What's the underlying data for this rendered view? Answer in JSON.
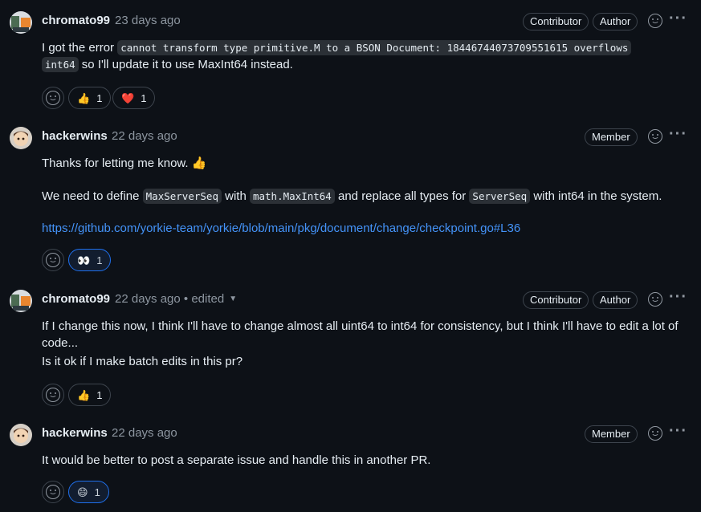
{
  "comments": [
    {
      "author": "chromato99",
      "time": "23 days ago",
      "badges": [
        "Contributor",
        "Author"
      ],
      "body": {
        "p1_pre": "I got the error ",
        "p1_code": "cannot transform type primitive.M to a BSON Document: 18446744073709551615 overflows",
        "p1_code2": "int64",
        "p1_post": " so I'll update it to use MaxInt64 instead."
      },
      "reactions": [
        {
          "emoji": "👍",
          "count": "1"
        },
        {
          "emoji": "❤️",
          "count": "1"
        }
      ]
    },
    {
      "author": "hackerwins",
      "time": "22 days ago",
      "badges": [
        "Member"
      ],
      "body": {
        "p1": "Thanks for letting me know. 👍",
        "p2_a": "We need to define ",
        "p2_code1": "MaxServerSeq",
        "p2_b": " with ",
        "p2_code2": "math.MaxInt64",
        "p2_c": " and replace all types for ",
        "p2_code3": "ServerSeq",
        "p2_d": " with int64 in the system.",
        "link": "https://github.com/yorkie-team/yorkie/blob/main/pkg/document/change/checkpoint.go#L36"
      },
      "reactions": [
        {
          "emoji": "👀",
          "count": "1"
        }
      ]
    },
    {
      "author": "chromato99",
      "time": "22 days ago",
      "edited": "• edited",
      "badges": [
        "Contributor",
        "Author"
      ],
      "body": {
        "p1": "If I change this now, I think I'll have to change almost all uint64 to int64 for consistency, but I think I'll have to edit a lot of code...",
        "p2": "Is it ok if I make batch edits in this pr?"
      },
      "reactions": [
        {
          "emoji": "👍",
          "count": "1"
        }
      ]
    },
    {
      "author": "hackerwins",
      "time": "22 days ago",
      "badges": [
        "Member"
      ],
      "body": {
        "p1": "It would be better to post a separate issue and handle this in another PR."
      },
      "reactions": [
        {
          "emoji": "😄",
          "count": "1"
        }
      ]
    }
  ]
}
